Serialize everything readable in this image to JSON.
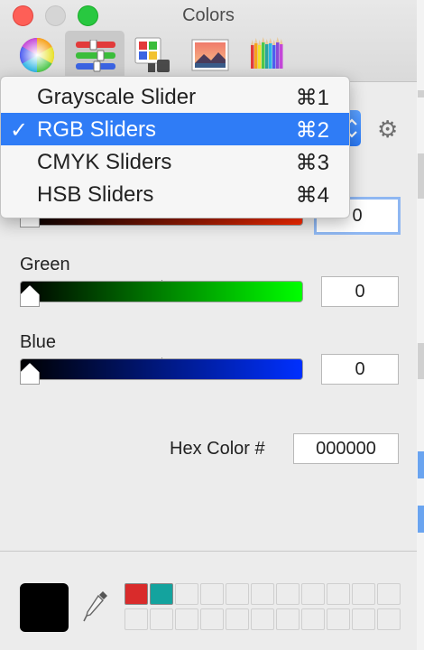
{
  "window": {
    "title": "Colors"
  },
  "toolbar": {
    "items": [
      {
        "name": "Color Wheel",
        "icon": "color-wheel-icon"
      },
      {
        "name": "Color Sliders",
        "icon": "sliders-icon",
        "selected": true
      },
      {
        "name": "Color Palettes",
        "icon": "palettes-icon"
      },
      {
        "name": "Image Palettes",
        "icon": "image-palette-icon"
      },
      {
        "name": "Pencils",
        "icon": "pencils-icon"
      }
    ]
  },
  "menu": {
    "items": [
      {
        "label": "Grayscale Slider",
        "shortcut": "⌘1",
        "checked": false
      },
      {
        "label": "RGB Sliders",
        "shortcut": "⌘2",
        "checked": true
      },
      {
        "label": "CMYK Sliders",
        "shortcut": "⌘3",
        "checked": false
      },
      {
        "label": "HSB Sliders",
        "shortcut": "⌘4",
        "checked": false
      }
    ],
    "check_mark": "✓"
  },
  "sliders": {
    "red": {
      "value": "0"
    },
    "green": {
      "label": "Green",
      "value": "0"
    },
    "blue": {
      "label": "Blue",
      "value": "0"
    }
  },
  "hex": {
    "label": "Hex Color #",
    "value": "000000"
  },
  "colors": {
    "current": "#000000",
    "saved_swatches": [
      "#d92b2b",
      "#14a39e"
    ],
    "accent": "#2f7cf6"
  }
}
